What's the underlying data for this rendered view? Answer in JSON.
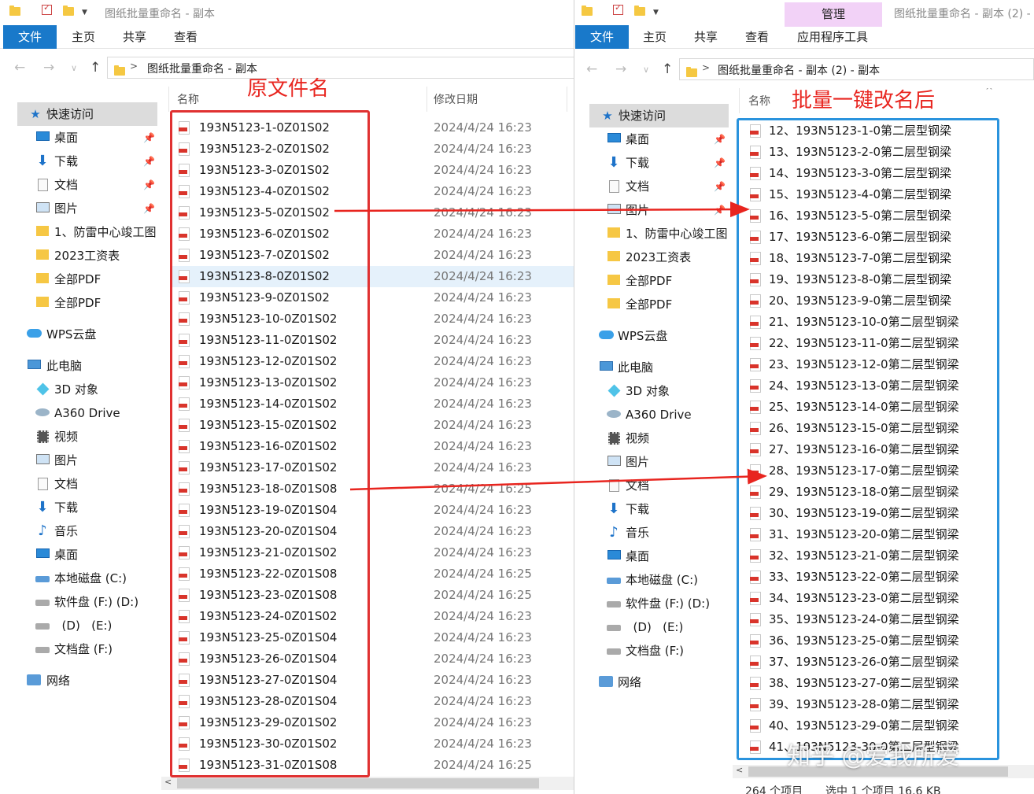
{
  "left": {
    "title": "图纸批量重命名 - 副本",
    "tabs": {
      "file": "文件",
      "home": "主页",
      "share": "共享",
      "view": "查看"
    },
    "address": "图纸批量重命名 - 副本",
    "col_name": "名称",
    "col_date": "修改日期",
    "annotation": "原文件名",
    "nav": {
      "quick_access": "快速访问",
      "desktop": "桌面",
      "downloads": "下载",
      "documents": "文档",
      "pictures": "图片",
      "f1": "1、防雷中心竣工图",
      "f2": "2023工资表",
      "f3": "全部PDF",
      "f4": "全部PDF",
      "wps": "WPS云盘",
      "this_pc": "此电脑",
      "objects3d": "3D 对象",
      "a360": "A360 Drive",
      "videos": "视频",
      "pictures2": "图片",
      "documents2": "文档",
      "downloads2": "下载",
      "music": "音乐",
      "desktop2": "桌面",
      "diskc": "本地磁盘 (C:)",
      "diskf": "软件盘  (F:)   (D:)",
      "diskd": "  (D)   (E:)",
      "diske": "文档盘 (F:)",
      "network": "网络"
    },
    "files": [
      {
        "name": "193N5123-1-0Z01S02",
        "date": "2024/4/24 16:23"
      },
      {
        "name": "193N5123-2-0Z01S02",
        "date": "2024/4/24 16:23"
      },
      {
        "name": "193N5123-3-0Z01S02",
        "date": "2024/4/24 16:23"
      },
      {
        "name": "193N5123-4-0Z01S02",
        "date": "2024/4/24 16:23"
      },
      {
        "name": "193N5123-5-0Z01S02",
        "date": "2024/4/24 16:23"
      },
      {
        "name": "193N5123-6-0Z01S02",
        "date": "2024/4/24 16:23"
      },
      {
        "name": "193N5123-7-0Z01S02",
        "date": "2024/4/24 16:23"
      },
      {
        "name": "193N5123-8-0Z01S02",
        "date": "2024/4/24 16:23"
      },
      {
        "name": "193N5123-9-0Z01S02",
        "date": "2024/4/24 16:23"
      },
      {
        "name": "193N5123-10-0Z01S02",
        "date": "2024/4/24 16:23"
      },
      {
        "name": "193N5123-11-0Z01S02",
        "date": "2024/4/24 16:23"
      },
      {
        "name": "193N5123-12-0Z01S02",
        "date": "2024/4/24 16:23"
      },
      {
        "name": "193N5123-13-0Z01S02",
        "date": "2024/4/24 16:23"
      },
      {
        "name": "193N5123-14-0Z01S02",
        "date": "2024/4/24 16:23"
      },
      {
        "name": "193N5123-15-0Z01S02",
        "date": "2024/4/24 16:23"
      },
      {
        "name": "193N5123-16-0Z01S02",
        "date": "2024/4/24 16:23"
      },
      {
        "name": "193N5123-17-0Z01S02",
        "date": "2024/4/24 16:23"
      },
      {
        "name": "193N5123-18-0Z01S08",
        "date": "2024/4/24 16:25"
      },
      {
        "name": "193N5123-19-0Z01S04",
        "date": "2024/4/24 16:23"
      },
      {
        "name": "193N5123-20-0Z01S04",
        "date": "2024/4/24 16:23"
      },
      {
        "name": "193N5123-21-0Z01S02",
        "date": "2024/4/24 16:23"
      },
      {
        "name": "193N5123-22-0Z01S08",
        "date": "2024/4/24 16:25"
      },
      {
        "name": "193N5123-23-0Z01S08",
        "date": "2024/4/24 16:25"
      },
      {
        "name": "193N5123-24-0Z01S02",
        "date": "2024/4/24 16:23"
      },
      {
        "name": "193N5123-25-0Z01S04",
        "date": "2024/4/24 16:23"
      },
      {
        "name": "193N5123-26-0Z01S04",
        "date": "2024/4/24 16:23"
      },
      {
        "name": "193N5123-27-0Z01S04",
        "date": "2024/4/24 16:23"
      },
      {
        "name": "193N5123-28-0Z01S04",
        "date": "2024/4/24 16:23"
      },
      {
        "name": "193N5123-29-0Z01S02",
        "date": "2024/4/24 16:23"
      },
      {
        "name": "193N5123-30-0Z01S02",
        "date": "2024/4/24 16:23"
      },
      {
        "name": "193N5123-31-0Z01S08",
        "date": "2024/4/24 16:25"
      }
    ]
  },
  "right": {
    "title": "图纸批量重命名 - 副本 (2) -",
    "manage": "管理",
    "tabs": {
      "file": "文件",
      "home": "主页",
      "share": "共享",
      "view": "查看",
      "apptools": "应用程序工具"
    },
    "address": "图纸批量重命名 - 副本 (2) - 副本",
    "col_name": "名称",
    "annotation": "批量一键改名后",
    "status_count": "264 个项目",
    "status_sel": "选中 1 个项目  16.6 KB",
    "nav": {
      "quick_access": "快速访问",
      "desktop": "桌面",
      "downloads": "下载",
      "documents": "文档",
      "pictures": "图片",
      "f1": "1、防雷中心竣工图",
      "f2": "2023工资表",
      "f3": "全部PDF",
      "f4": "全部PDF",
      "wps": "WPS云盘",
      "this_pc": "此电脑",
      "objects3d": "3D 对象",
      "a360": "A360 Drive",
      "videos": "视频",
      "pictures2": "图片",
      "documents2": "文档",
      "downloads2": "下载",
      "music": "音乐",
      "desktop2": "桌面",
      "diskc": "本地磁盘 (C:)",
      "diskf": "软件盘  (F:)   (D:)",
      "diskd": "  (D)   (E:)",
      "diske": "文档盘 (F:)",
      "network": "网络"
    },
    "files": [
      "12、193N5123-1-0第二层型钢梁",
      "13、193N5123-2-0第二层型钢梁",
      "14、193N5123-3-0第二层型钢梁",
      "15、193N5123-4-0第二层型钢梁",
      "16、193N5123-5-0第二层型钢梁",
      "17、193N5123-6-0第二层型钢梁",
      "18、193N5123-7-0第二层型钢梁",
      "19、193N5123-8-0第二层型钢梁",
      "20、193N5123-9-0第二层型钢梁",
      "21、193N5123-10-0第二层型钢梁",
      "22、193N5123-11-0第二层型钢梁",
      "23、193N5123-12-0第二层型钢梁",
      "24、193N5123-13-0第二层型钢梁",
      "25、193N5123-14-0第二层型钢梁",
      "26、193N5123-15-0第二层型钢梁",
      "27、193N5123-16-0第二层型钢梁",
      "28、193N5123-17-0第二层型钢梁",
      "29、193N5123-18-0第二层型钢梁",
      "30、193N5123-19-0第二层型钢梁",
      "31、193N5123-20-0第二层型钢梁",
      "32、193N5123-21-0第二层型钢梁",
      "33、193N5123-22-0第二层型钢梁",
      "34、193N5123-23-0第二层型钢梁",
      "35、193N5123-24-0第二层型钢梁",
      "36、193N5123-25-0第二层型钢梁",
      "37、193N5123-26-0第二层型钢梁",
      "38、193N5123-27-0第二层型钢梁",
      "39、193N5123-28-0第二层型钢梁",
      "40、193N5123-29-0第二层型钢梁",
      "41、193N5123-30-0第二层型钢梁"
    ]
  },
  "watermark": "知乎 @爱我所爱",
  "colors": {
    "file_tab": "#1979ca",
    "manage": "#f2d2f7",
    "red": "#e03131",
    "blue": "#2a93dd"
  }
}
